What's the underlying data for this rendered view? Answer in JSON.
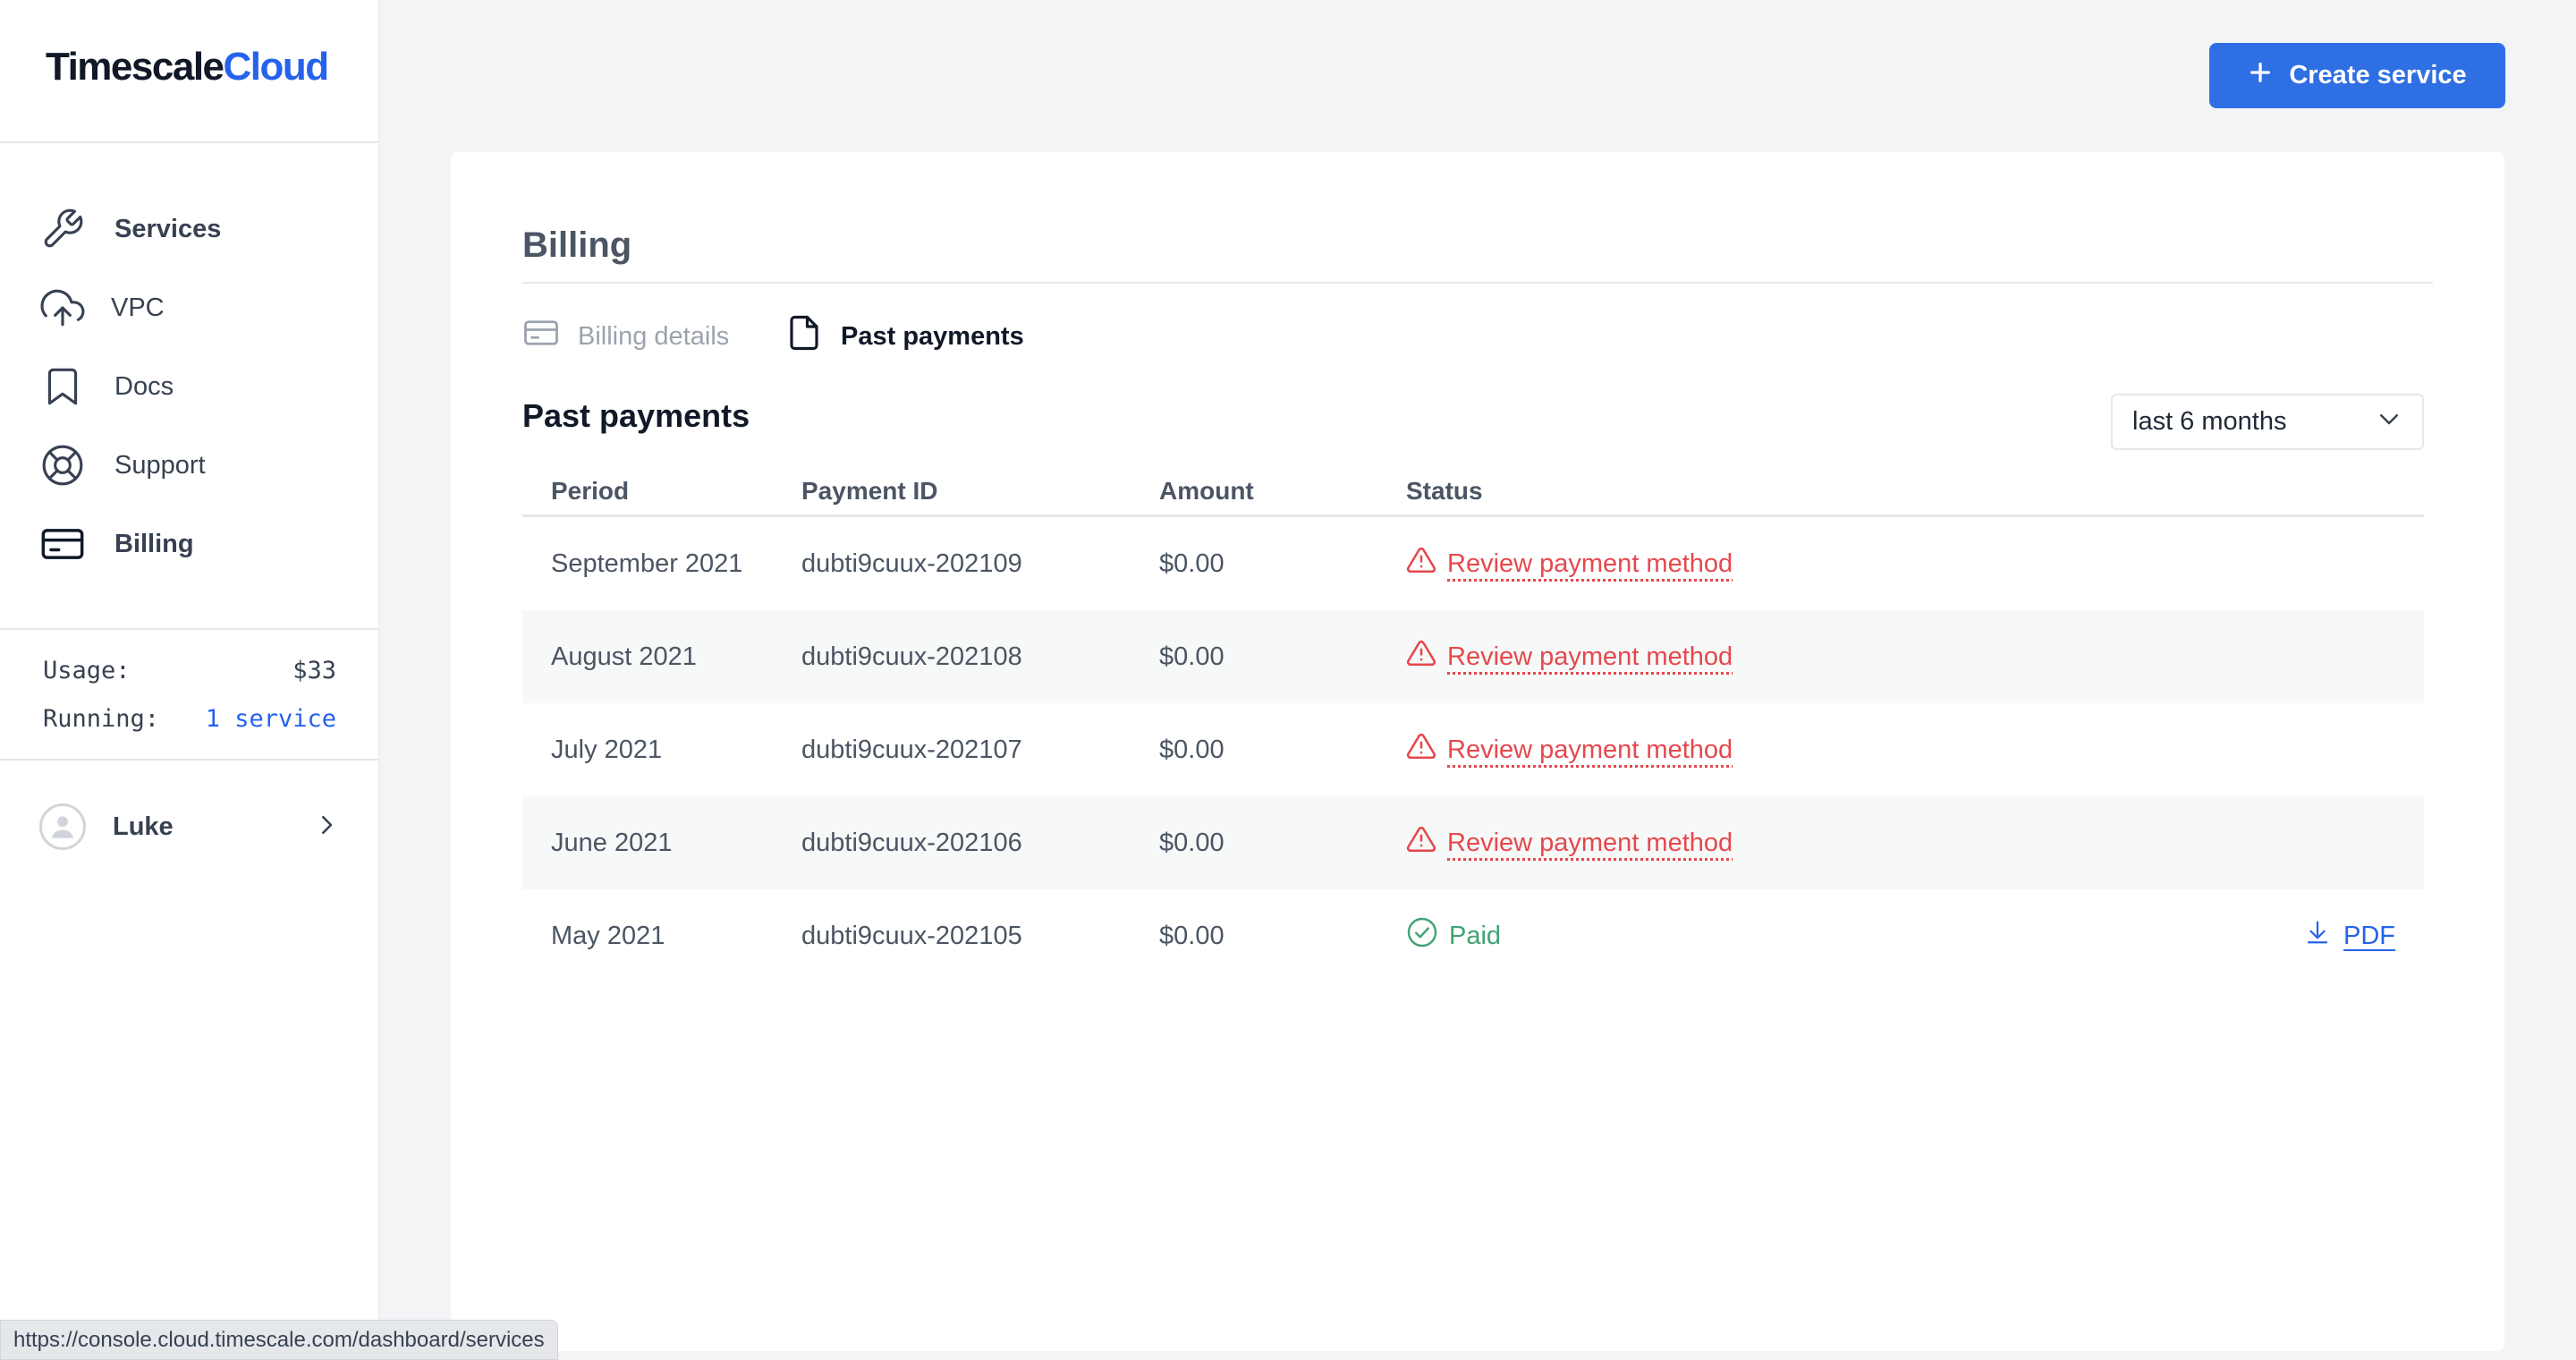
{
  "logo": {
    "part1": "Timescale",
    "part2": "Cloud"
  },
  "colors": {
    "accent": "#2f6fe4",
    "warning": "#e5484d",
    "success": "#3fa372"
  },
  "sidebar": {
    "items": [
      {
        "label": "Services",
        "icon": "wrench-icon"
      },
      {
        "label": "VPC",
        "icon": "cloud-upload-icon"
      },
      {
        "label": "Docs",
        "icon": "bookmark-icon"
      },
      {
        "label": "Support",
        "icon": "lifebuoy-icon"
      },
      {
        "label": "Billing",
        "icon": "credit-card-icon"
      }
    ],
    "usage_label": "Usage:",
    "usage_value": "$33",
    "running_label": "Running:",
    "running_value": "1 service",
    "user_name": "Luke"
  },
  "header": {
    "create_label": "Create service"
  },
  "billing": {
    "title": "Billing",
    "tabs": [
      {
        "label": "Billing details",
        "icon": "credit-card-icon",
        "active": false
      },
      {
        "label": "Past payments",
        "icon": "document-icon",
        "active": true
      }
    ],
    "section_title": "Past payments",
    "range_select": "last 6 months"
  },
  "table": {
    "headers": [
      "Period",
      "Payment ID",
      "Amount",
      "Status"
    ],
    "rows": [
      {
        "period": "September 2021",
        "id": "dubti9cuux-202109",
        "amount": "$0.00",
        "status": "Review payment method"
      },
      {
        "period": "August 2021",
        "id": "dubti9cuux-202108",
        "amount": "$0.00",
        "status": "Review payment method"
      },
      {
        "period": "July 2021",
        "id": "dubti9cuux-202107",
        "amount": "$0.00",
        "status": "Review payment method"
      },
      {
        "period": "June 2021",
        "id": "dubti9cuux-202106",
        "amount": "$0.00",
        "status": "Review payment method"
      },
      {
        "period": "May 2021",
        "id": "dubti9cuux-202105",
        "amount": "$0.00",
        "status": "Paid",
        "download": "PDF"
      }
    ]
  },
  "status_url": "https://console.cloud.timescale.com/dashboard/services"
}
